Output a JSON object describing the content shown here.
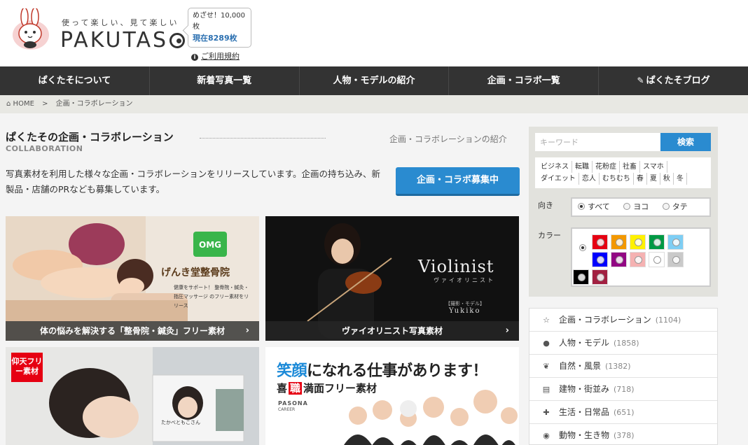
{
  "header": {
    "logo_tagline": "使って楽しい、見て楽しい",
    "logo_name": "PAKUTAS",
    "counter_goal": "めざせ！10,000枚",
    "counter_now": "現在8289枚",
    "terms_link": "ご利用規約"
  },
  "nav": {
    "items": [
      {
        "label": "ぱくたそについて"
      },
      {
        "label": "新着写真一覧"
      },
      {
        "label": "人物・モデルの紹介"
      },
      {
        "label": "企画・コラボ一覧"
      },
      {
        "label": "ぱくたそブログ"
      }
    ]
  },
  "breadcrumb": {
    "home": "HOME",
    "separator": ">",
    "current": "企画・コラボレーション"
  },
  "main": {
    "title": "ぱくたその企画・コラボレーション",
    "title_en": "COLLABORATION",
    "section_intro": "企画・コラボレーションの紹介",
    "description": "写真素材を利用した様々な企画・コラボレーションをリリースしています。企画の持ち込み、新製品・店舗のPRなども募集しています。",
    "cta_label": "企画・コラボ募集中",
    "cards": [
      {
        "caption": "体の悩みを解決する「整骨院・鍼灸」フリー素材",
        "clinic_name": "げんき堂整骨院",
        "clinic_text": "健康をサポート！ 整骨院・鍼灸・指圧マッサージ のフリー素材をリリース"
      },
      {
        "caption": "ヴァイオリニスト写真素材",
        "title": "Violinist",
        "subtitle": "ヴァイオリニスト",
        "model": "Yukiko",
        "model_label": "【撮影・モデル】"
      },
      {
        "badge": "仰天フリー素材",
        "name_tag": "たかべともこさん"
      },
      {
        "headline_em": "笑顔",
        "headline_rest": "になれる仕事があります！",
        "sub1": "喜",
        "sub2": "職",
        "sub3": "満面フリー素材",
        "brand": "PASONA",
        "brand_sub": "CAREER"
      }
    ]
  },
  "sidebar": {
    "search_placeholder": "キーワード",
    "search_button": "検索",
    "tags": [
      "ビジネス",
      "転職",
      "花粉症",
      "社畜",
      "スマホ",
      "ダイエット",
      "恋人",
      "むちむち",
      "春",
      "夏",
      "秋",
      "冬"
    ],
    "orientation_label": "向き",
    "orientation_options": [
      {
        "label": "すべて",
        "selected": true
      },
      {
        "label": "ヨコ",
        "selected": false
      },
      {
        "label": "タテ",
        "selected": false
      }
    ],
    "color_label": "カラー",
    "colors": [
      "#e60012",
      "#f39800",
      "#fff100",
      "#009944",
      "#7ecef4",
      "#0000ff",
      "#920783",
      "#f5b2b2",
      "#ffffff",
      "#c9c9c9",
      "#000000",
      "#a22041"
    ],
    "categories": [
      {
        "icon": "star-icon",
        "label": "企画・コラボレーション",
        "count": "(1104)"
      },
      {
        "icon": "person-icon",
        "label": "人物・モデル",
        "count": "(1858)"
      },
      {
        "icon": "leaf-icon",
        "label": "自然・風景",
        "count": "(1382)"
      },
      {
        "icon": "building-icon",
        "label": "建物・街並み",
        "count": "(718)"
      },
      {
        "icon": "puzzle-icon",
        "label": "生活・日常品",
        "count": "(651)"
      },
      {
        "icon": "globe-icon",
        "label": "動物・生き物",
        "count": "(378)"
      }
    ]
  }
}
